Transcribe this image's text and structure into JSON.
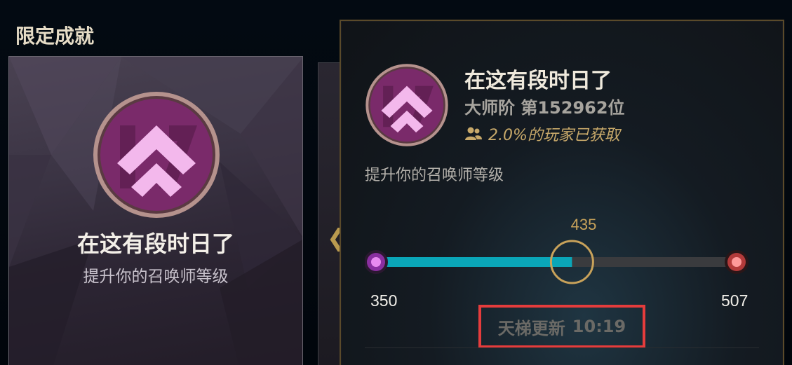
{
  "section": {
    "title": "限定成就"
  },
  "card": {
    "title": "在这有段时日了",
    "description": "提升你的召唤师等级",
    "emblem_icon": "level-up-chevron-icon"
  },
  "navigation": {
    "prev_icon": "chevron-left-icon",
    "prev_glyph": "❮"
  },
  "tooltip": {
    "title": "在这有段时日了",
    "rank_text": "大师阶 第152962位",
    "owned_text": "2.0%的玩家已获取",
    "owned_icon": "players-icon",
    "description": "提升你的召唤师等级",
    "progress": {
      "current": "435",
      "min": "350",
      "max": "507",
      "fraction": 0.54
    },
    "ladder": {
      "label": "天梯更新",
      "time": "10:19"
    }
  },
  "colors": {
    "accent_gold": "#c8a25a",
    "progress_fill": "#0aa6b8",
    "emblem_purple": "#7a2a6a",
    "highlight_red": "#e53c3c"
  }
}
